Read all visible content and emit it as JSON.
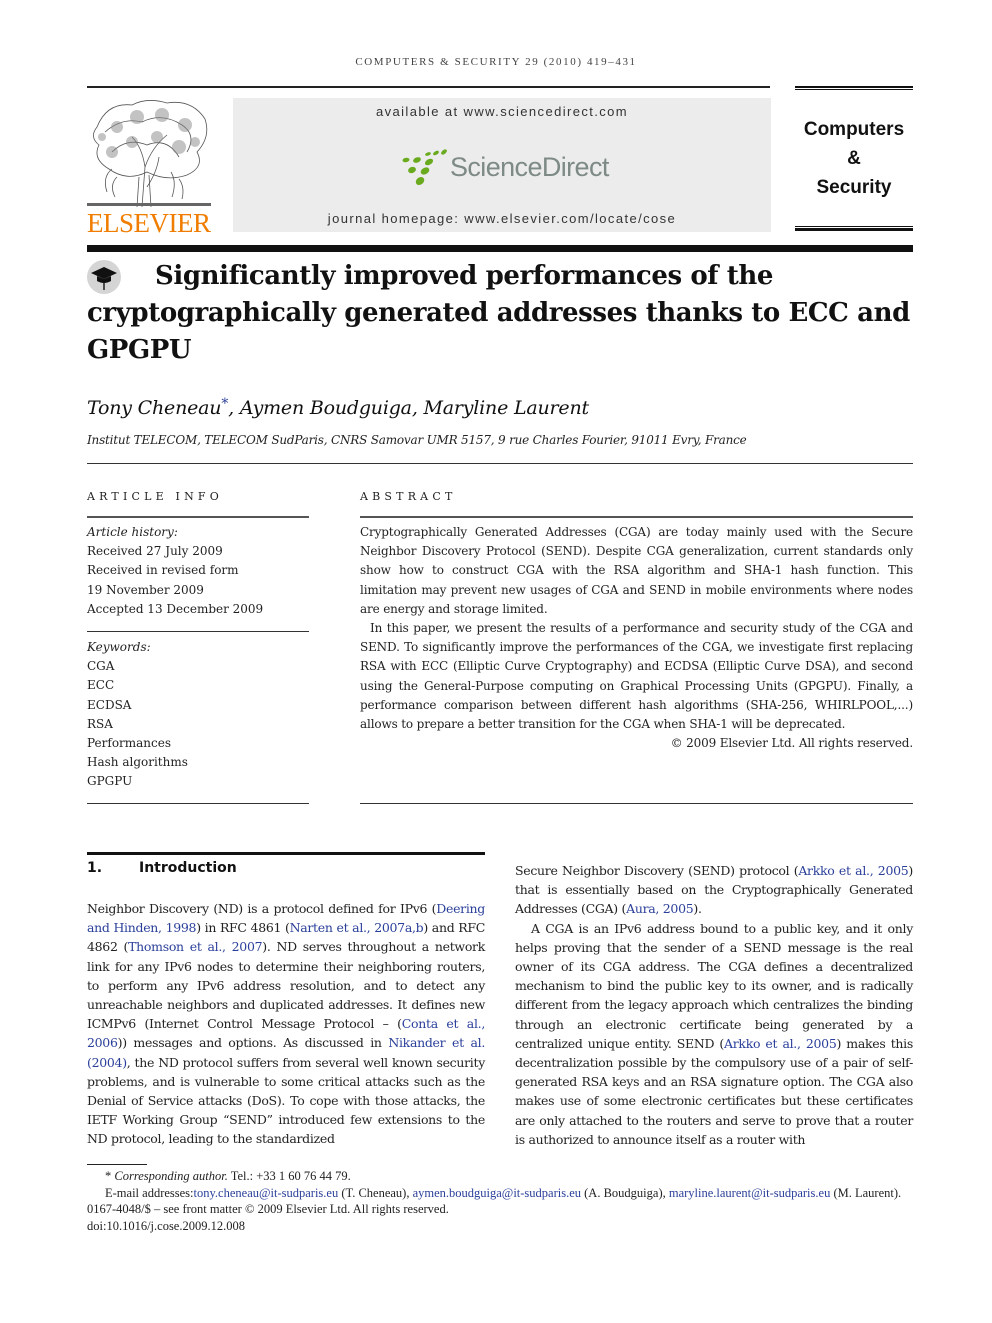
{
  "running_head": "COMPUTERS & SECURITY 29 (2010) 419–431",
  "masthead": {
    "publisher_logo_text": "ELSEVIER",
    "available_at": "available at www.sciencedirect.com",
    "sciencedirect_logo_text": "ScienceDirect",
    "journal_homepage": "journal homepage: www.elsevier.com/locate/cose",
    "journal_title_lines": [
      "Computers",
      "&",
      "Security"
    ],
    "colors": {
      "elsevier_orange": "#f07d00",
      "sciencedirect_green": "#6aaa1e",
      "sciencedirect_gray": "#7d8a86",
      "link_blue": "#2a3f9a"
    }
  },
  "article": {
    "title": "Significantly improved performances of the cryptographically generated addresses thanks to ECC and GPGPU",
    "title_icon": "mortarboard-icon",
    "authors": [
      "Tony Cheneau",
      "Aymen Boudguiga",
      "Maryline Laurent"
    ],
    "corresponding_marker": "*",
    "affiliation": "Institut TELECOM, TELECOM SudParis, CNRS Samovar UMR 5157, 9 rue Charles Fourier, 91011 Evry, France"
  },
  "article_info": {
    "heading": "ARTICLE INFO",
    "history_label": "Article history:",
    "history": [
      "Received 27 July 2009",
      "Received in revised form",
      "19 November 2009",
      "Accepted 13 December 2009"
    ],
    "keywords_label": "Keywords:",
    "keywords": [
      "CGA",
      "ECC",
      "ECDSA",
      "RSA",
      "Performances",
      "Hash algorithms",
      "GPGPU"
    ]
  },
  "abstract": {
    "heading": "ABSTRACT",
    "paragraphs": [
      "Cryptographically Generated Addresses (CGA) are today mainly used with the Secure Neighbor Discovery Protocol (SEND). Despite CGA generalization, current standards only show how to construct CGA with the RSA algorithm and SHA-1 hash function. This limitation may prevent new usages of CGA and SEND in mobile environments where nodes are energy and storage limited.",
      "In this paper, we present the results of a performance and security study of the CGA and SEND. To significantly improve the performances of the CGA, we investigate first replacing RSA with ECC (Elliptic Curve Cryptography) and ECDSA (Elliptic Curve DSA), and second using the General-Purpose computing on Graphical Processing Units (GPGPU). Finally, a performance comparison between different hash algorithms (SHA-256, WHIRLPOOL,...) allows to prepare a better transition for the CGA when SHA-1 will be deprecated."
    ],
    "copyright": "© 2009 Elsevier Ltd. All rights reserved."
  },
  "introduction": {
    "number": "1.",
    "heading": "Introduction",
    "left": {
      "t1": "Neighbor Discovery (ND) is a protocol defined for IPv6 (",
      "l1": "Deering and Hinden, 1998",
      "t2": ") in RFC 4861 (",
      "l2": "Narten et al., 2007a,b",
      "t3": ") and RFC 4862 (",
      "l3": "Thomson et al., 2007",
      "t4": "). ND serves throughout a network link for any IPv6 nodes to determine their neighboring routers, to perform any IPv6 address resolution, and to detect any unreachable neighbors and duplicated addresses. It defines new ICMPv6 (Internet Control Message Protocol – (",
      "l4": "Conta et al., 2006",
      "t5": ")) messages and options. As discussed in ",
      "l5": "Nikander et al. (2004)",
      "t6": ", the ND protocol suffers from several well known security problems, and is vulnerable to some critical attacks such as the Denial of Service attacks (DoS). To cope with those attacks, the IETF Working Group “SEND” introduced few extensions to the ND protocol, leading to the standardized"
    },
    "right_p1": {
      "t1": "Secure Neighbor Discovery (SEND) protocol (",
      "l1": "Arkko et al., 2005",
      "t2": ") that is essentially based on the Cryptographically Generated Addresses (CGA) (",
      "l2": "Aura, 2005",
      "t3": ")."
    },
    "right_p2": {
      "t1": "A CGA is an IPv6 address bound to a public key, and it only helps proving that the sender of a SEND message is the real owner of its CGA address. The CGA defines a decentralized mechanism to bind the public key to its owner, and is radically different from the legacy approach which centralizes the binding through an electronic certificate being generated by a centralized unique entity. SEND (",
      "l1": "Arkko et al., 2005",
      "t2": ") makes this decentralization possible by the compulsory use of a pair of self-generated RSA keys and an RSA signature option. The CGA also makes use of some electronic certificates but these certificates are only attached to the routers and serve to prove that a router is authorized to announce itself as a router with"
    }
  },
  "footnotes": {
    "marker": "*",
    "corresponding_label": "Corresponding author.",
    "tel": " Tel.: +33 1 60 76 44 79.",
    "email_label": "E-mail addresses: ",
    "emails": [
      {
        "address": "tony.cheneau@it-sudparis.eu",
        "name": " (T. Cheneau), "
      },
      {
        "address": "aymen.boudguiga@it-sudparis.eu",
        "name": " (A. Boudguiga), "
      },
      {
        "address": "maryline.laurent@it-sudparis.eu",
        "name": " (M. Laurent)."
      }
    ],
    "front_matter": "0167-4048/$ – see front matter © 2009 Elsevier Ltd. All rights reserved.",
    "doi": "doi:10.1016/j.cose.2009.12.008"
  }
}
